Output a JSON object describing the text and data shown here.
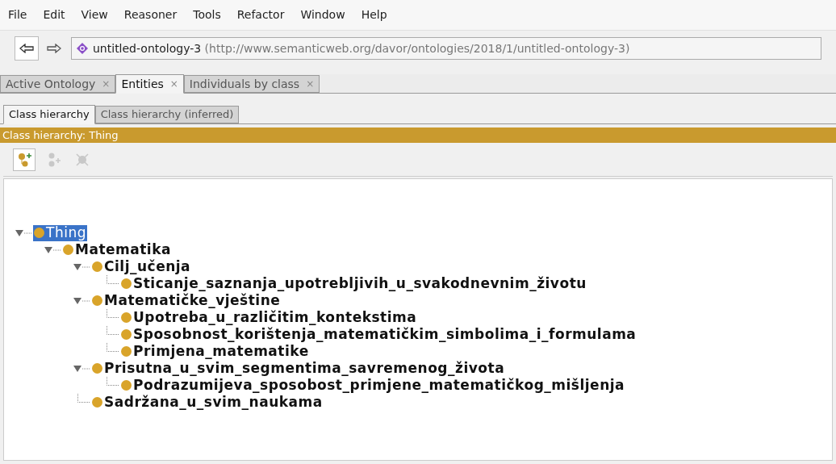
{
  "menu_bar": [
    "File",
    "Edit",
    "View",
    "Reasoner",
    "Tools",
    "Refactor",
    "Window",
    "Help"
  ],
  "navigation": {
    "ontology_name": "untitled-ontology-3",
    "ontology_iri": "(http://www.semanticweb.org/davor/ontologies/2018/1/untitled-ontology-3)"
  },
  "tabs": [
    {
      "label": "Active Ontology",
      "close": "×",
      "selected": false
    },
    {
      "label": "Entities",
      "close": "×",
      "selected": true
    },
    {
      "label": "Individuals by class",
      "close": "×",
      "selected": false
    }
  ],
  "sub_tabs": [
    {
      "label": "Class hierarchy",
      "selected": true
    },
    {
      "label": "Class hierarchy (inferred)",
      "selected": false
    }
  ],
  "view_header": "Class hierarchy: Thing",
  "toolbar": [
    {
      "kind": "add-subclass",
      "disabled": false
    },
    {
      "kind": "add-sibling",
      "disabled": true
    },
    {
      "kind": "delete",
      "disabled": true
    }
  ],
  "tree": [
    {
      "label": "Thing",
      "selected": true,
      "expanded": true,
      "children": [
        {
          "label": "Matematika",
          "selected": false,
          "expanded": true,
          "children": [
            {
              "label": "Cilj_učenja",
              "selected": false,
              "expanded": true,
              "children": [
                {
                  "label": "Sticanje_saznanja_upotrebljivih_u_svakodnevnim_životu",
                  "selected": false
                }
              ]
            },
            {
              "label": "Matematičke_vještine",
              "selected": false,
              "expanded": true,
              "children": [
                {
                  "label": "Upotreba_u_različitim_kontekstima",
                  "selected": false
                },
                {
                  "label": "Sposobnost_korištenja_matematičkim_simbolima_i_formulama",
                  "selected": false
                },
                {
                  "label": "Primjena_matematike",
                  "selected": false
                }
              ]
            },
            {
              "label": "Prisutna_u_svim_segmentima_savremenog_života",
              "selected": false,
              "expanded": true,
              "children": [
                {
                  "label": "Podrazumijeva_sposobost_primjene_matematičkog_mišljenja",
                  "selected": false
                }
              ]
            },
            {
              "label": "Sadržana_u_svim_naukama",
              "selected": false
            }
          ]
        }
      ]
    }
  ]
}
